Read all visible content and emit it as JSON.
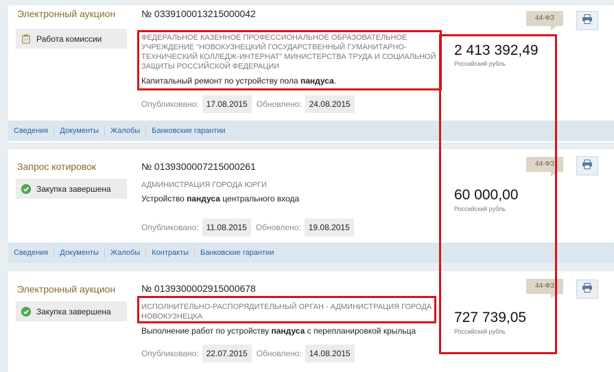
{
  "cards": [
    {
      "type": "Электронный аукцион",
      "status": "Работа комиссии",
      "status_icon": "clipboard-icon",
      "regnum": "№ 0339100013215000042",
      "customer": "ФЕДЕРАЛЬНОЕ КАЗЕННОЕ ПРОФЕССИОНАЛЬНОЕ ОБРАЗОВАТЕЛЬНОЕ УЧРЕЖДЕНИЕ \"НОВОКУЗНЕЦКИЙ ГОСУДАРСТВЕННЫЙ ГУМАНИТАРНО-ТЕХНИЧЕСКИЙ КОЛЛЕДЖ-ИНТЕРНАТ\" МИНИСТЕРСТВА ТРУДА И СОЦИАЛЬНОЙ ЗАЩИТЫ РОССИЙСКОЙ ФЕДЕРАЦИИ",
      "subject_before": "Капитальный ремонт по устройству пола ",
      "subject_bold": "пандуса",
      "subject_after": ".",
      "published_label": "Опубликовано:",
      "published": "17.08.2015",
      "updated_label": "Обновлено:",
      "updated": "24.08.2015",
      "price": "2 413 392,49",
      "currency": "Российский рубль",
      "law": "44-ФЗ",
      "tabs": [
        "Сведения",
        "Документы",
        "Жалобы",
        "Банковские гарантии"
      ]
    },
    {
      "type": "Запрос котировок",
      "status": "Закупка завершена",
      "status_icon": "check-circle-icon",
      "regnum": "№ 0139300007215000261",
      "customer": "АДМИНИСТРАЦИЯ ГОРОДА ЮРГИ",
      "subject_before": "Устройство ",
      "subject_bold": "пандуса",
      "subject_after": " центрального входа",
      "published_label": "Опубликовано:",
      "published": "11.08.2015",
      "updated_label": "Обновлено:",
      "updated": "19.08.2015",
      "price": "60 000,00",
      "currency": "Российский рубль",
      "law": "44-ФЗ",
      "tabs": [
        "Сведения",
        "Документы",
        "Жалобы",
        "Контракты",
        "Банковские гарантии"
      ]
    },
    {
      "type": "Электронный аукцион",
      "status": "Закупка завершена",
      "status_icon": "check-circle-icon",
      "regnum": "№ 0139300002915000678",
      "customer": "ИСПОЛНИТЕЛЬНО-РАСПОРЯДИТЕЛЬНЫЙ ОРГАН - АДМИНИСТРАЦИЯ ГОРОДА НОВОКУЗНЕЦКА",
      "subject_before": "Выполнение работ по устройству ",
      "subject_bold": "пандуса",
      "subject_after": " с перепланировкой крыльца",
      "published_label": "Опубликовано:",
      "published": "22.07.2015",
      "updated_label": "Обновлено:",
      "updated": "14.08.2015",
      "price": "727 739,05",
      "currency": "Российский рубль",
      "law": "44-ФЗ",
      "tabs": []
    }
  ],
  "colors": {
    "highlight": "#d8121b",
    "card_type": "#8a6a2a",
    "link": "#2560a8"
  }
}
